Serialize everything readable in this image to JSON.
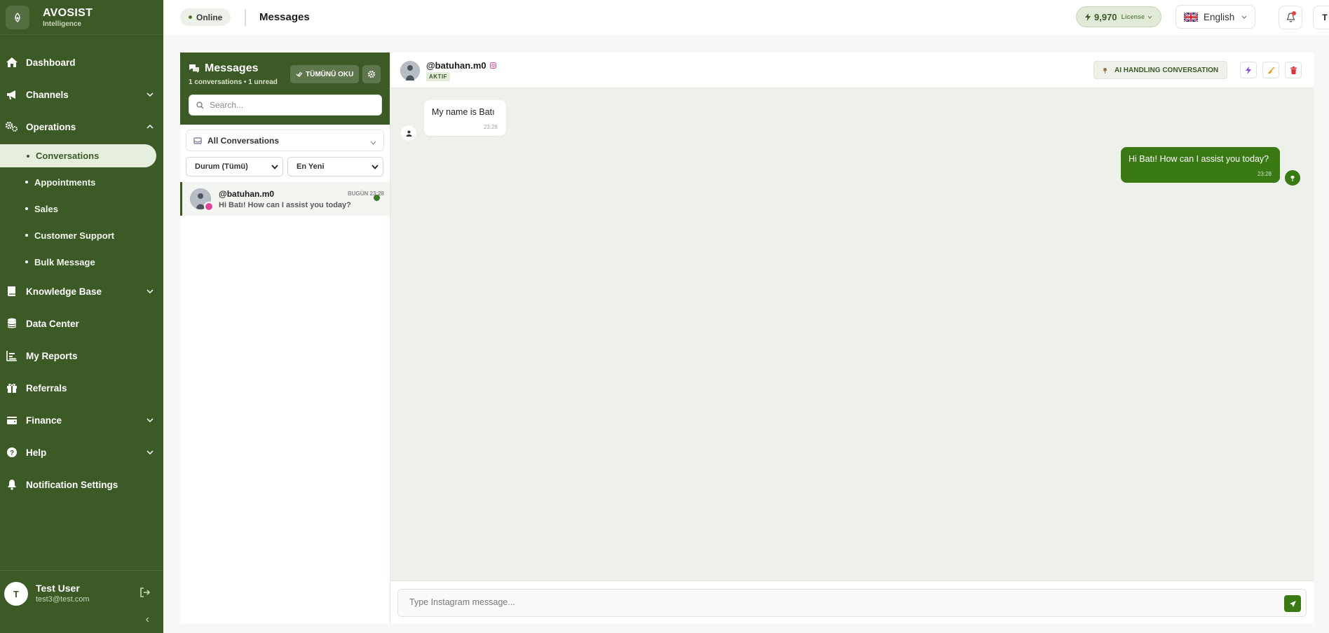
{
  "brand": {
    "name": "AVOSIST",
    "subtitle": "Intelligence"
  },
  "sidebar": {
    "items": [
      {
        "label": "Dashboard"
      },
      {
        "label": "Channels"
      },
      {
        "label": "Operations"
      },
      {
        "label": "Knowledge Base"
      },
      {
        "label": "Data Center"
      },
      {
        "label": "My Reports"
      },
      {
        "label": "Referrals"
      },
      {
        "label": "Finance"
      },
      {
        "label": "Help"
      },
      {
        "label": "Notification Settings"
      }
    ],
    "operations_sub": [
      {
        "label": "Conversations"
      },
      {
        "label": "Appointments"
      },
      {
        "label": "Sales"
      },
      {
        "label": "Customer Support"
      },
      {
        "label": "Bulk Message"
      }
    ],
    "user": {
      "initial": "T",
      "name": "Test User",
      "email": "test3@test.com"
    }
  },
  "topbar": {
    "status": "Online",
    "title": "Messages",
    "license_value": "9,970",
    "license_label": "License",
    "language": "English",
    "user_initial": "T"
  },
  "list_panel": {
    "title": "Messages",
    "subtitle": "1 conversations • 1 unread",
    "read_all_label": "TÜMÜNÜ OKU",
    "search_placeholder": "Search...",
    "filter_label": "All Conversations",
    "status_select": "Durum (Tümü)",
    "sort_select": "En Yeni",
    "conversations": [
      {
        "name": "@batuhan.m0",
        "time": "BUGÜN 23:28",
        "preview": "Hi Batı! How can I assist you today?"
      }
    ]
  },
  "chat": {
    "contact_name": "@batuhan.m0",
    "contact_status": "AKTIF",
    "ai_label": "AI HANDLING CONVERSATION",
    "messages": [
      {
        "text": "My name is Batı",
        "time": "23:28"
      },
      {
        "text": "Hi Batı! How can I assist you today?",
        "time": "23:28"
      }
    ],
    "composer_placeholder": "Type Instagram message..."
  },
  "colors": {
    "brand_green": "#3c5a26",
    "bubble_green": "#3a7a14",
    "instagram_pink": "#e0439a"
  }
}
